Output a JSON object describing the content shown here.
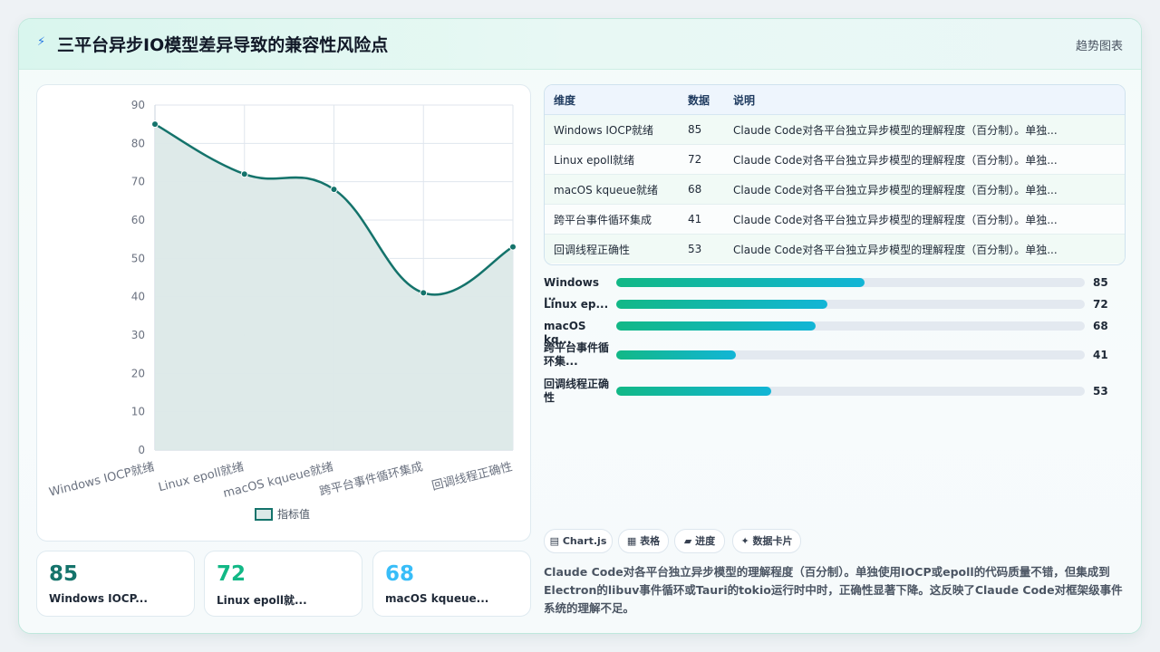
{
  "header": {
    "icon": "lightning-icon",
    "title": "三平台异步IO模型差异导致的兼容性风险点",
    "right_link": "趋势图表"
  },
  "chart_data": {
    "type": "line",
    "categories": [
      "Windows IOCP就绪",
      "Linux epoll就绪",
      "macOS kqueue就绪",
      "跨平台事件循环集成",
      "回调线程正确性"
    ],
    "series": [
      {
        "name": "指标值",
        "values": [
          85,
          72,
          68,
          41,
          53
        ]
      }
    ],
    "ylim": [
      0,
      90
    ],
    "yticks": [
      0,
      10,
      20,
      30,
      40,
      50,
      60,
      70,
      80,
      90
    ],
    "grid": true,
    "legend": "bottom",
    "color": "#14736b",
    "fill": "#dce9e8"
  },
  "stat_cards": [
    {
      "value": "85",
      "label": "Windows IOCP...",
      "color": "#14736b"
    },
    {
      "value": "72",
      "label": "Linux epoll就...",
      "color": "#12b886"
    },
    {
      "value": "68",
      "label": "macOS kqueue...",
      "color": "#38bdf8"
    }
  ],
  "table": {
    "headers": [
      "维度",
      "数据",
      "说明"
    ],
    "rows": [
      {
        "name": "Windows IOCP就绪",
        "value": "85",
        "desc": "Claude Code对各平台独立异步模型的理解程度（百分制）。单独..."
      },
      {
        "name": "Linux epoll就绪",
        "value": "72",
        "desc": "Claude Code对各平台独立异步模型的理解程度（百分制）。单独..."
      },
      {
        "name": "macOS kqueue就绪",
        "value": "68",
        "desc": "Claude Code对各平台独立异步模型的理解程度（百分制）。单独..."
      },
      {
        "name": "跨平台事件循环集成",
        "value": "41",
        "desc": "Claude Code对各平台独立异步模型的理解程度（百分制）。单独..."
      },
      {
        "name": "回调线程正确性",
        "value": "53",
        "desc": "Claude Code对各平台独立异步模型的理解程度（百分制）。单独..."
      }
    ]
  },
  "progress": [
    {
      "label": "Windows ...",
      "value": 85,
      "display": "85",
      "fraction": 0.53
    },
    {
      "label": "Linux ep...",
      "value": 72,
      "display": "72",
      "fraction": 0.45
    },
    {
      "label": "macOS kq...",
      "value": 68,
      "display": "68",
      "fraction": 0.425
    },
    {
      "label": "跨平台事件循环集...",
      "value": 41,
      "display": "41",
      "fraction": 0.255
    },
    {
      "label": "回调线程正确性",
      "value": 53,
      "display": "53",
      "fraction": 0.33
    }
  ],
  "tags": [
    {
      "icon": "grid-icon",
      "label": "Chart.js"
    },
    {
      "icon": "table-icon",
      "label": "表格"
    },
    {
      "icon": "progress-icon",
      "label": "进度"
    },
    {
      "icon": "sparkle-icon",
      "label": "数据卡片"
    }
  ],
  "description": "Claude Code对各平台独立异步模型的理解程度（百分制）。单独使用IOCP或epoll的代码质量不错，但集成到Electron的libuv事件循环或Tauri的tokio运行时中时，正确性显著下降。这反映了Claude Code对框架级事件系统的理解不足。"
}
